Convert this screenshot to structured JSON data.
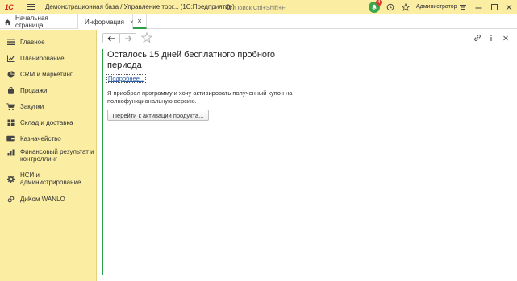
{
  "app": {
    "logo_text": "1С",
    "title": "Демонстрационная база / Управление торг...  (1С:Предприятие)"
  },
  "search": {
    "placeholder": "Поиск Ctrl+Shift+F"
  },
  "notifications": {
    "count": "4"
  },
  "user": {
    "name": "Администратор"
  },
  "tabs": {
    "home_label": "Начальная страница",
    "info_label": "Информация",
    "close_glyph": "×"
  },
  "sidebar": {
    "items": [
      {
        "label": "Главное",
        "icon": "menu-lines-icon"
      },
      {
        "label": "Планирование",
        "icon": "chart-icon"
      },
      {
        "label": "CRM и маркетинг",
        "icon": "pie-icon"
      },
      {
        "label": "Продажи",
        "icon": "shopping-bag-icon"
      },
      {
        "label": "Закупки",
        "icon": "cart-icon"
      },
      {
        "label": "Склад и доставка",
        "icon": "warehouse-icon"
      },
      {
        "label": "Казначейство",
        "icon": "wallet-icon"
      },
      {
        "label": "Финансовый результат и контроллинг",
        "icon": "finance-icon"
      },
      {
        "label": "НСИ и администрирование",
        "icon": "gear-icon"
      },
      {
        "label": "ДиКом WANLO",
        "icon": "link-icon"
      }
    ]
  },
  "content": {
    "heading": "Осталось 15 дней бесплатного пробного периода",
    "more_link": "Подробнее...",
    "paragraph": "Я приобрел программу и хочу активировать полученный купон на полнофункциональную версию.",
    "activate_button": "Перейти к активации продукта..."
  },
  "colors": {
    "accent_green": "#2e9e48",
    "panel_yellow": "#fbeda2",
    "logo_red": "#d52b1e",
    "badge_red": "#e23b2e"
  }
}
